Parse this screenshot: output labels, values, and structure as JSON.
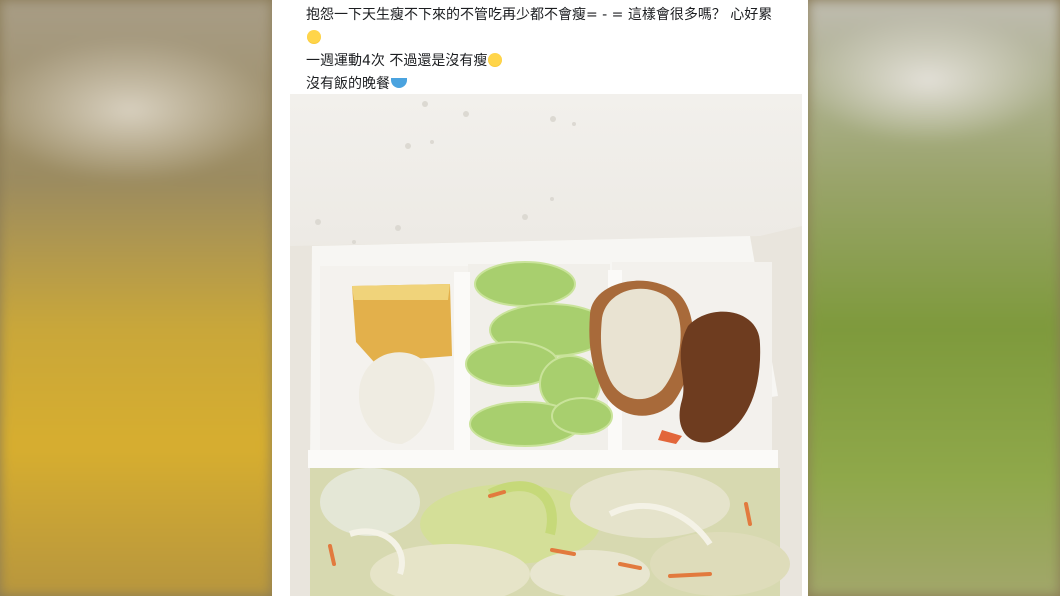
{
  "post": {
    "caption_line1": "抱怨一下天生瘦不下來的不管吃再少都不會瘦= - = 這樣會很多嗎？ 心好累",
    "caption_line2": "一週運動4次 不過還是沒有瘦",
    "caption_line3": "沒有飯的晚餐",
    "emoji_1": "crying-face-icon",
    "emoji_2": "laughing-tears-icon",
    "emoji_3": "bowl-icon"
  },
  "colors": {
    "background_left": "#c9a73a",
    "background_right": "#7e9a3c",
    "post_bg": "#ffffff",
    "text": "#1c1e21"
  }
}
